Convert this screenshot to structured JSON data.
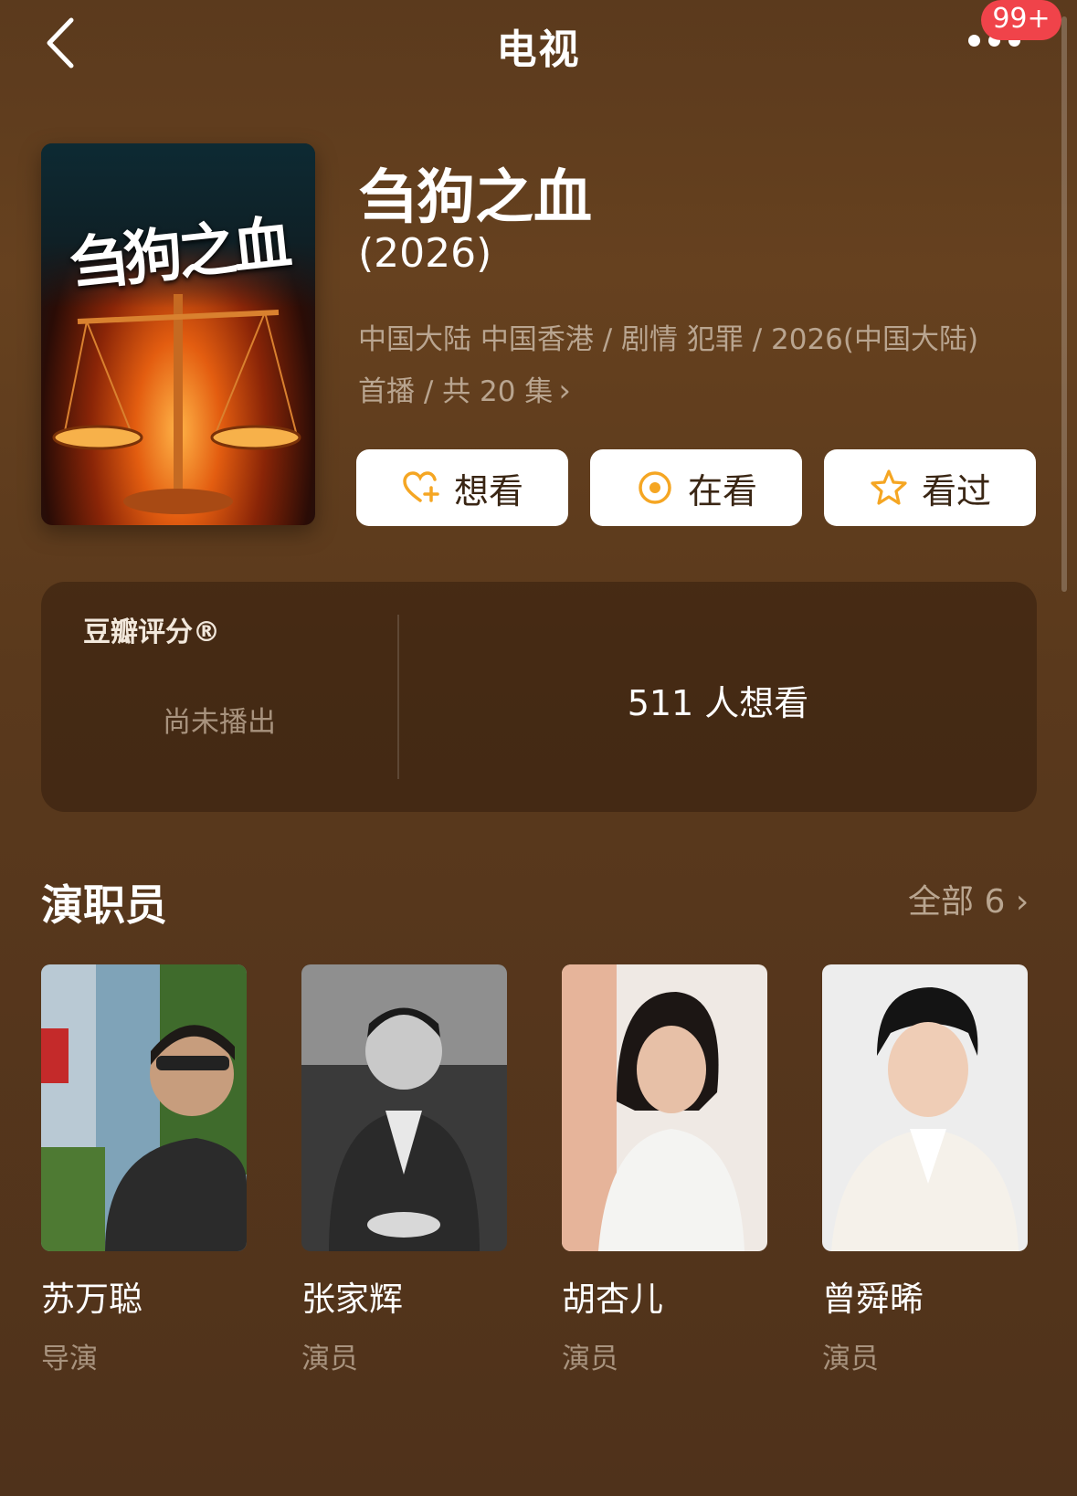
{
  "header": {
    "title": "电视",
    "back_icon": "chevron-left-icon",
    "more_icon": "more-dots-icon",
    "notification_badge": "99+",
    "badge_color": "#f0434a"
  },
  "show": {
    "poster_title": "刍狗之血",
    "title": "刍狗之血",
    "year": "(2026)",
    "meta_line1": "中国大陆 中国香港 / 剧情 犯罪 / 2026(中国大陆)",
    "meta_line2": "首播 / 共 20 集",
    "meta_more_icon": "chevron-right-icon"
  },
  "actions": [
    {
      "label": "想看",
      "icon": "heart-plus-icon"
    },
    {
      "label": "在看",
      "icon": "target-circle-icon"
    },
    {
      "label": "看过",
      "icon": "star-outline-icon"
    }
  ],
  "accent_color": "#f5a623",
  "rating": {
    "label": "豆瓣评分®",
    "status": "尚未播出",
    "wish_count": "511 人想看"
  },
  "cast": {
    "title": "演职员",
    "all_label": "全部 6",
    "all_icon": "chevron-right-icon",
    "members": [
      {
        "name": "苏万聪",
        "role": "导演"
      },
      {
        "name": "张家辉",
        "role": "演员"
      },
      {
        "name": "胡杏儿",
        "role": "演员"
      },
      {
        "name": "曾舜晞",
        "role": "演员"
      }
    ]
  }
}
